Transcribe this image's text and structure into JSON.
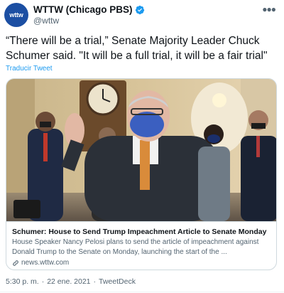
{
  "author": {
    "display_name": "WTTW (Chicago PBS)",
    "handle": "@wttw",
    "avatar_text": "wttw",
    "verified": true
  },
  "tweet": {
    "text": "“There will be a trial,” Senate Majority Leader Chuck Schumer said. \"It will be a full trial, it will be a fair trial\"",
    "translate_label": "Traducir Tweet"
  },
  "link_card": {
    "image_description": "Senate Majority Leader Chuck Schumer waving, wearing a blue mask, walking through the Capitol with others behind him",
    "title": "Schumer: House to Send Trump Impeachment Article to Senate Monday",
    "description": "House Speaker Nancy Pelosi plans to send the article of impeachment against Donald Trump to the Senate on Monday, launching the start of the ...",
    "domain": "news.wttw.com"
  },
  "meta": {
    "time": "5:30 p. m.",
    "separator": "·",
    "date": "22 ene. 2021",
    "separator2": "·",
    "client": "TweetDeck"
  },
  "colors": {
    "brand_blue": "#1c4fa3",
    "link_blue": "#1d9bf0",
    "verified_blue": "#1d9bf0",
    "text_primary": "#0f1419",
    "text_secondary": "#536471"
  },
  "icons": {
    "verified": "verified-badge-icon",
    "more": "more-options-icon",
    "link": "link-icon"
  }
}
